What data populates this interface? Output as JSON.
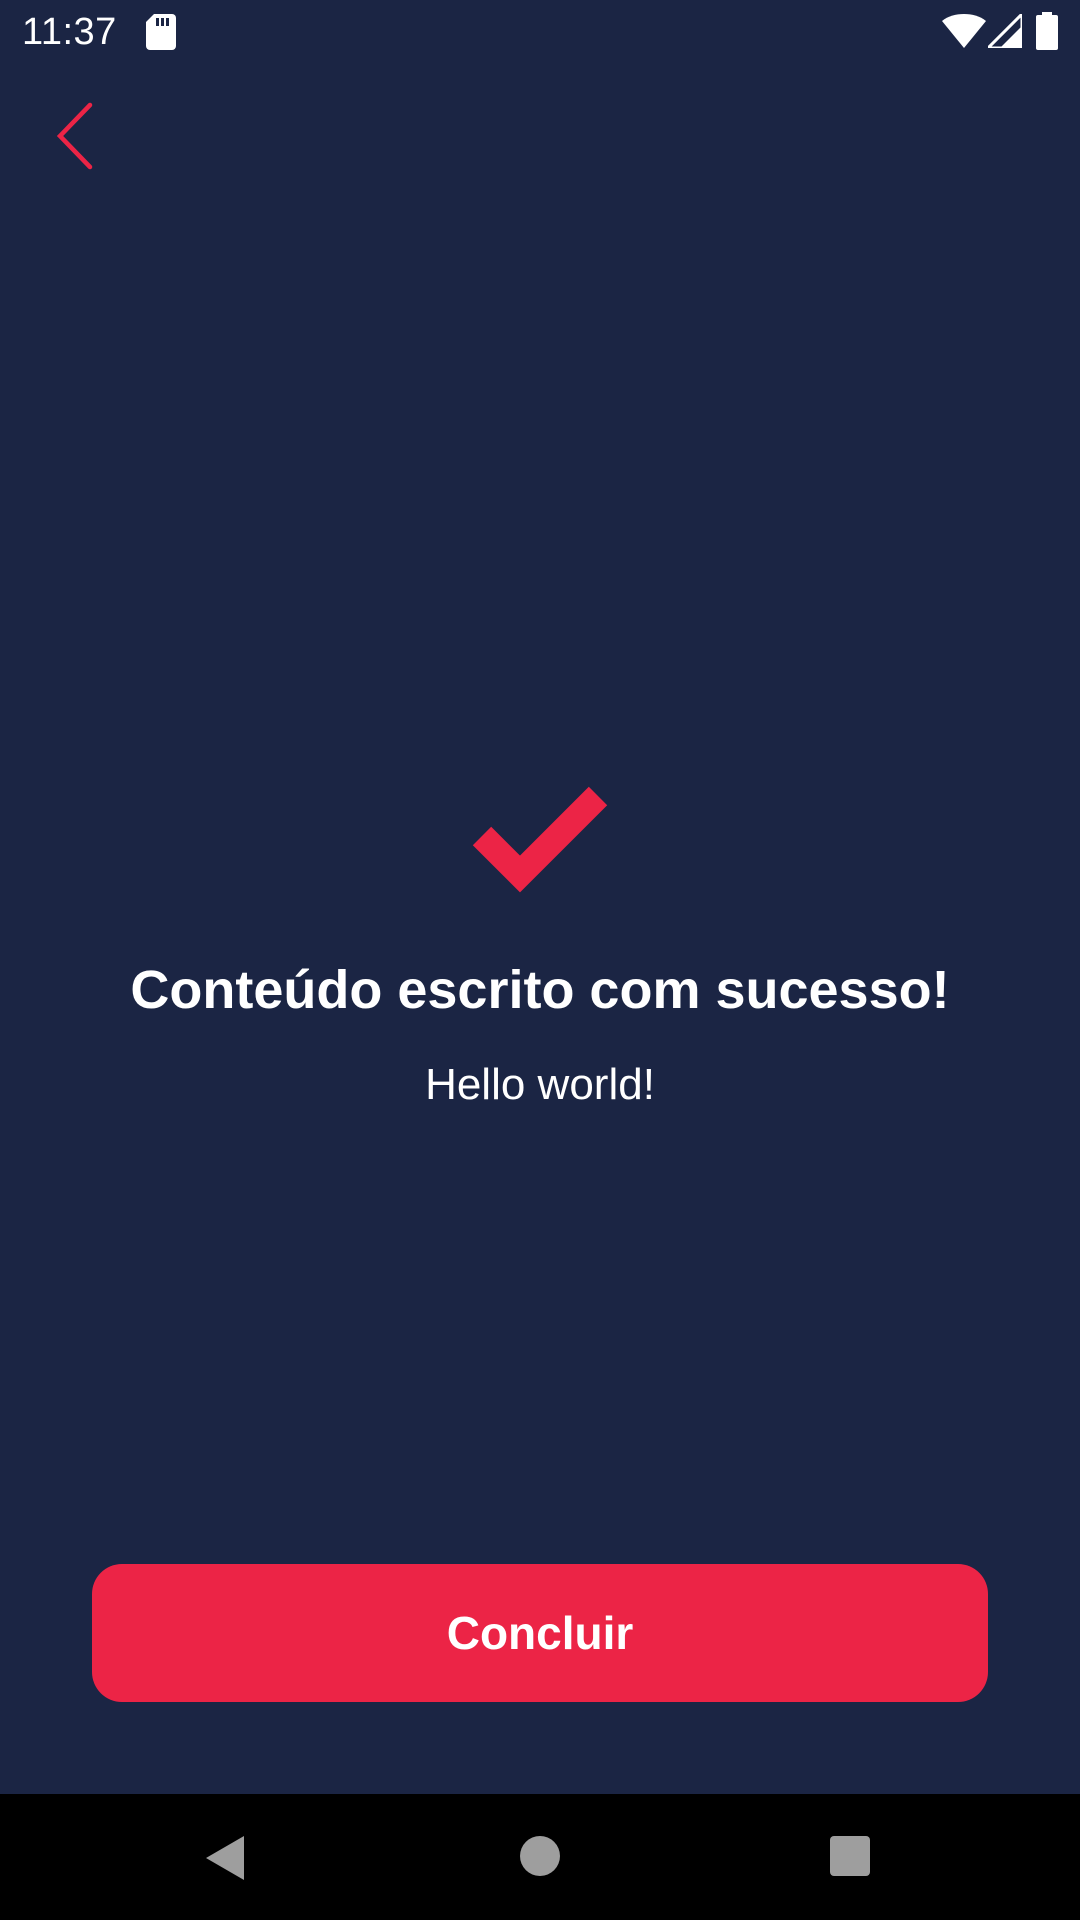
{
  "status_bar": {
    "time": "11:37",
    "icons": [
      "sd-card-icon",
      "wifi-icon",
      "cell-signal-icon",
      "battery-icon"
    ]
  },
  "header": {
    "back_icon": "chevron-left-icon"
  },
  "content": {
    "icon": "checkmark-icon",
    "title": "Conteúdo escrito com sucesso!",
    "message": "Hello world!"
  },
  "actions": {
    "conclude_label": "Concluir"
  },
  "nav_bar": {
    "buttons": [
      "back-triangle-icon",
      "home-circle-icon",
      "recents-square-icon"
    ]
  },
  "colors": {
    "background": "#1b2544",
    "accent": "#ec2446",
    "text": "#ffffff",
    "nav_background": "#000000",
    "nav_icon": "#9e9e9e"
  }
}
